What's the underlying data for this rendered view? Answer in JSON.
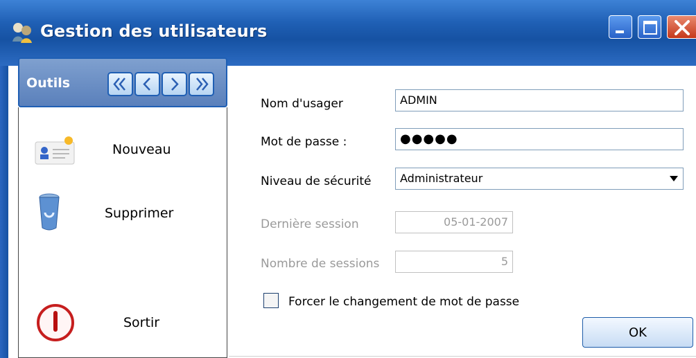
{
  "window": {
    "title": "Gestion des utilisateurs",
    "controls": [
      "minimize-icon",
      "maximize-icon",
      "close-icon"
    ]
  },
  "colors": {
    "titlebar": "#1f5fb4",
    "close_button": "#c5381b",
    "disabled_text": "#9a9a9a"
  },
  "sidebar": {
    "header": "Outils",
    "nav_buttons": [
      "first-icon",
      "previous-icon",
      "next-icon",
      "last-icon"
    ],
    "items": [
      {
        "label": "Nouveau",
        "icon": "new-user-card-icon"
      },
      {
        "label": "Supprimer",
        "icon": "recycle-bin-icon"
      },
      {
        "label": "Sortir",
        "icon": "exit-power-icon"
      }
    ]
  },
  "form": {
    "username_label": "Nom d'usager",
    "username_value": "ADMIN",
    "password_label": "Mot de passe :",
    "password_value": "●●●●●",
    "security_label": "Niveau de sécurité",
    "security_value": "Administrateur",
    "last_session_label": "Dernière session",
    "last_session_value": "05-01-2007",
    "sessions_count_label": "Nombre de sessions",
    "sessions_count_value": "5",
    "force_change_label": "Forcer le changement de mot de passe",
    "ok_label": "OK"
  }
}
